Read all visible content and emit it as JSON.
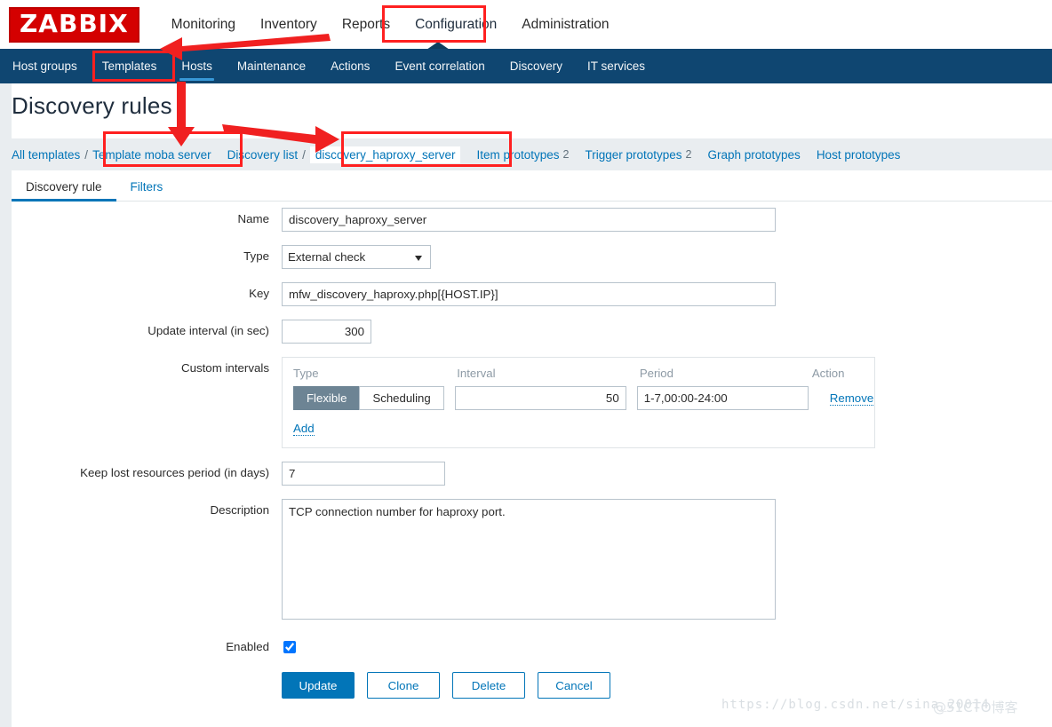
{
  "brand": {
    "name": "ZABBIX"
  },
  "topnav": {
    "items": [
      {
        "label": "Monitoring",
        "active": false
      },
      {
        "label": "Inventory",
        "active": false
      },
      {
        "label": "Reports",
        "active": false
      },
      {
        "label": "Configuration",
        "active": true
      },
      {
        "label": "Administration",
        "active": false
      }
    ]
  },
  "subnav": {
    "items": [
      {
        "label": "Host groups",
        "active": false
      },
      {
        "label": "Templates",
        "active": false
      },
      {
        "label": "Hosts",
        "active": true
      },
      {
        "label": "Maintenance",
        "active": false
      },
      {
        "label": "Actions",
        "active": false
      },
      {
        "label": "Event correlation",
        "active": false
      },
      {
        "label": "Discovery",
        "active": false
      },
      {
        "label": "IT services",
        "active": false
      }
    ]
  },
  "page": {
    "title": "Discovery rules"
  },
  "breadcrumb": {
    "all_templates": "All templates",
    "sep": "/",
    "template_name": "Template moba server",
    "discovery_list": "Discovery list",
    "current": "discovery_haproxy_server",
    "item_prototypes": "Item prototypes",
    "item_prototypes_count": "2",
    "trigger_prototypes": "Trigger prototypes",
    "trigger_prototypes_count": "2",
    "graph_prototypes": "Graph prototypes",
    "host_prototypes": "Host prototypes"
  },
  "tabs": [
    {
      "label": "Discovery rule",
      "active": true
    },
    {
      "label": "Filters",
      "active": false
    }
  ],
  "form": {
    "name_label": "Name",
    "name_value": "discovery_haproxy_server",
    "type_label": "Type",
    "type_value": "External check",
    "type_options": [
      "External check"
    ],
    "key_label": "Key",
    "key_value": "mfw_discovery_haproxy.php[{HOST.IP}]",
    "update_interval_label": "Update interval (in sec)",
    "update_interval_value": "300",
    "custom_intervals_label": "Custom intervals",
    "custom_intervals": {
      "header": {
        "type": "Type",
        "interval": "Interval",
        "period": "Period",
        "action": "Action"
      },
      "rows": [
        {
          "type_flexible": "Flexible",
          "type_scheduling": "Scheduling",
          "type_selected": "Flexible",
          "interval": "50",
          "period": "1-7,00:00-24:00",
          "action": "Remove"
        }
      ],
      "add_label": "Add"
    },
    "keep_lost_label": "Keep lost resources period (in days)",
    "keep_lost_value": "7",
    "description_label": "Description",
    "description_value": "TCP connection number for haproxy port.",
    "enabled_label": "Enabled",
    "enabled_checked": true
  },
  "buttons": {
    "update": "Update",
    "clone": "Clone",
    "delete": "Delete",
    "cancel": "Cancel"
  },
  "watermark": {
    "url": "https://blog.csdn.net/sina_20014",
    "tag": "@51CTO博客"
  },
  "colors": {
    "brand_red": "#d40000",
    "subnav_bg": "#0f4671",
    "link_blue": "#0275b8",
    "accent_underline": "#3b9ddd",
    "annotation_red": "#ff2020",
    "segment_selected": "#6d8494",
    "page_bg": "#e9edf0"
  }
}
